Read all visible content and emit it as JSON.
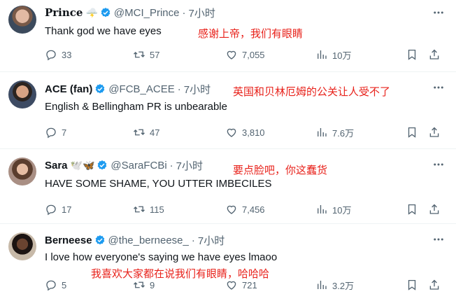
{
  "tweets": [
    {
      "name": "Prince",
      "emoji": "🌩️",
      "handle": "@MCI_Prince",
      "time": "7小时",
      "text": "Thank god we have eyes",
      "translation": "感谢上帝，我们有眼睛",
      "replies": "33",
      "retweets": "57",
      "likes": "7,055",
      "views": "10万"
    },
    {
      "name": "ACE (fan)",
      "handle": "@FCB_ACEE",
      "time": "7小时",
      "text": "English & Bellingham PR is unbearable",
      "translation": "英国和贝林厄姆的公关让人受不了",
      "replies": "7",
      "retweets": "47",
      "likes": "3,810",
      "views": "7.6万"
    },
    {
      "name": "Sara",
      "emoji": "🕊️🦋",
      "handle": "@SaraFCBi",
      "time": "7小时",
      "text": "HAVE SOME SHAME, YOU UTTER IMBECILES",
      "translation": "要点脸吧，你这蠢货",
      "replies": "17",
      "retweets": "115",
      "likes": "7,456",
      "views": "10万"
    },
    {
      "name": "Berneese",
      "handle": "@the_berneese_",
      "time": "7小时",
      "text": "I love how everyone's saying we have eyes lmaoo",
      "translation": "我喜欢大家都在说我们有眼睛，哈哈哈",
      "replies": "5",
      "retweets": "9",
      "likes": "721",
      "views": "3.2万"
    }
  ],
  "colors": {
    "verified": "#1d9bf0",
    "translation": "#e8221b",
    "muted": "#536471"
  },
  "icons": [
    "more-icon",
    "reply-icon",
    "retweet-icon",
    "like-icon",
    "views-icon",
    "bookmark-icon",
    "share-icon",
    "verified-badge-icon"
  ]
}
